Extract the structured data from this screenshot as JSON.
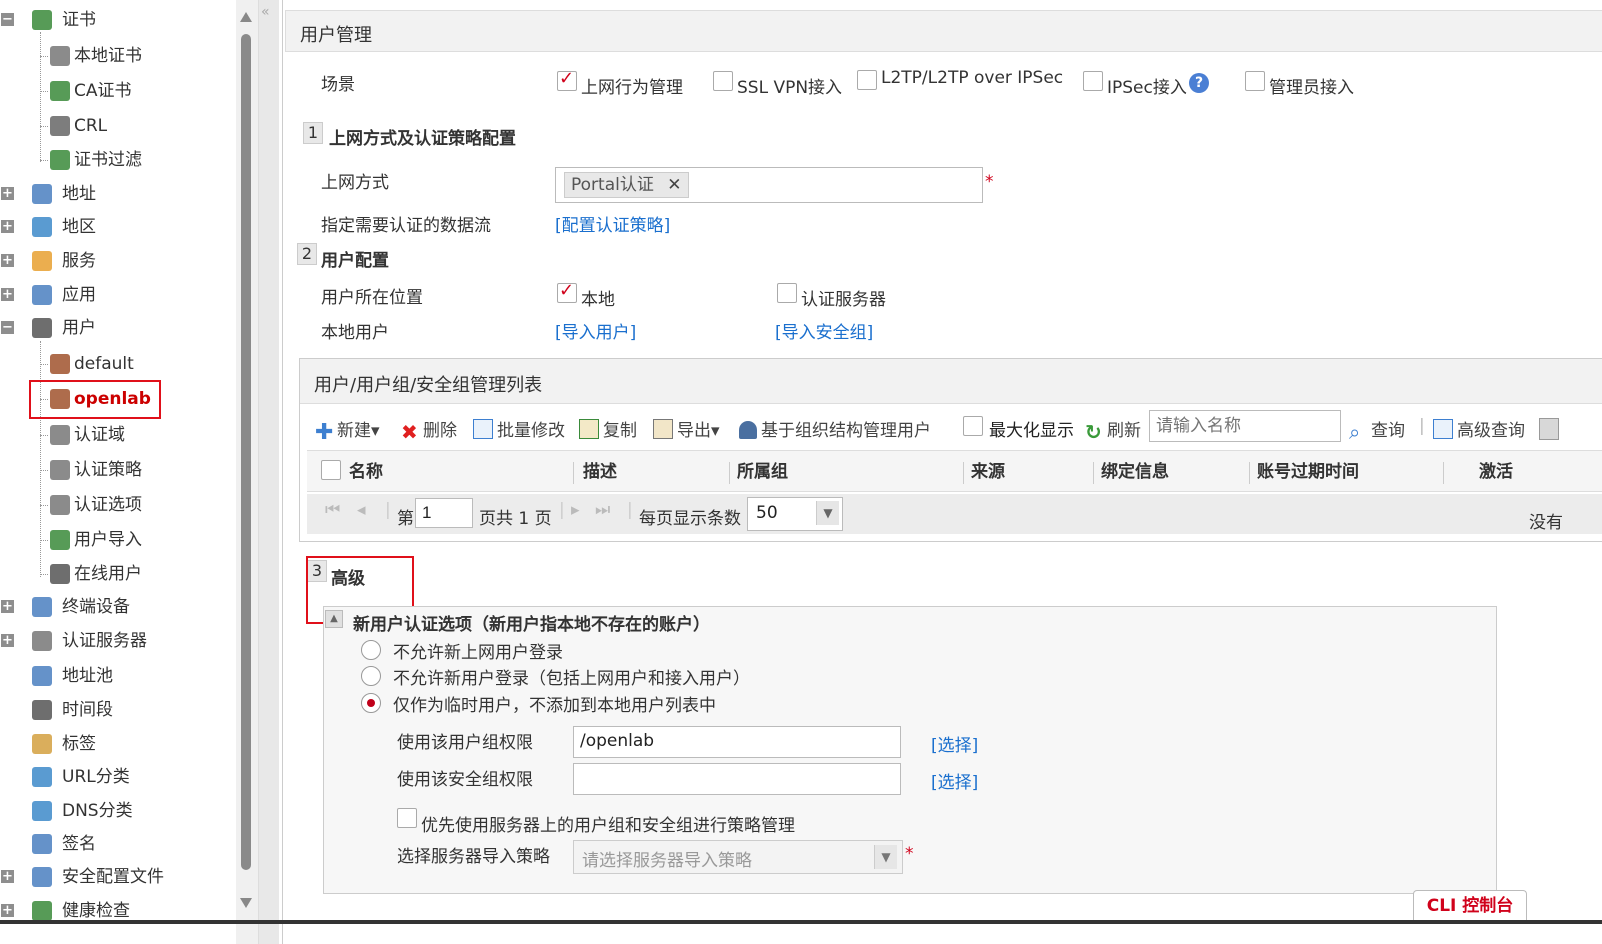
{
  "tree": {
    "items": [
      {
        "label": "证书",
        "level": 0,
        "expand": "minus",
        "color": "#3a8a3a"
      },
      {
        "label": "本地证书",
        "level": 1,
        "color": "#777"
      },
      {
        "label": "CA证书",
        "level": 1,
        "color": "#3a8a3a"
      },
      {
        "label": "CRL",
        "level": 1,
        "color": "#666"
      },
      {
        "label": "证书过滤",
        "level": 1,
        "color": "#3a8a3a"
      },
      {
        "label": "地址",
        "level": 0,
        "expand": "plus",
        "color": "#4a7fc0"
      },
      {
        "label": "地区",
        "level": 0,
        "expand": "plus",
        "color": "#3d8ac9"
      },
      {
        "label": "服务",
        "level": 0,
        "expand": "plus",
        "color": "#e8a030"
      },
      {
        "label": "应用",
        "level": 0,
        "expand": "plus",
        "color": "#4a7fc0"
      },
      {
        "label": "用户",
        "level": 0,
        "expand": "minus",
        "color": "#555"
      },
      {
        "label": "default",
        "level": 1,
        "color": "#a0522d"
      },
      {
        "label": "openlab",
        "level": 1,
        "color": "#a0522d",
        "selected": true
      },
      {
        "label": "认证域",
        "level": 1,
        "color": "#777"
      },
      {
        "label": "认证策略",
        "level": 1,
        "color": "#777"
      },
      {
        "label": "认证选项",
        "level": 1,
        "color": "#777"
      },
      {
        "label": "用户导入",
        "level": 1,
        "color": "#3a8a3a"
      },
      {
        "label": "在线用户",
        "level": 1,
        "color": "#555"
      },
      {
        "label": "终端设备",
        "level": 0,
        "expand": "plus",
        "color": "#4a7fc0"
      },
      {
        "label": "认证服务器",
        "level": 0,
        "expand": "plus",
        "color": "#777"
      },
      {
        "label": "地址池",
        "level": 0,
        "color": "#4a7fc0"
      },
      {
        "label": "时间段",
        "level": 0,
        "color": "#555"
      },
      {
        "label": "标签",
        "level": 0,
        "color": "#d4a040"
      },
      {
        "label": "URL分类",
        "level": 0,
        "color": "#3d8ac9"
      },
      {
        "label": "DNS分类",
        "level": 0,
        "color": "#3d8ac9"
      },
      {
        "label": "签名",
        "level": 0,
        "color": "#4a7fc0"
      },
      {
        "label": "安全配置文件",
        "level": 0,
        "expand": "plus",
        "color": "#4a7fc0"
      },
      {
        "label": "健康检查",
        "level": 0,
        "expand": "plus",
        "color": "#3a8a3a"
      }
    ]
  },
  "main": {
    "panel_title": "用户管理",
    "scene_label": "场景",
    "scenes": [
      {
        "label": "上网行为管理",
        "checked": true
      },
      {
        "label": "SSL VPN接入",
        "checked": false
      },
      {
        "label": "L2TP/L2TP over IPSec",
        "checked": false
      },
      {
        "label": "IPSec接入",
        "checked": false
      },
      {
        "label": "管理员接入",
        "checked": false
      }
    ],
    "help_icon": "question-icon",
    "step1": {
      "num": "1",
      "title": "上网方式及认证策略配置"
    },
    "access_label": "上网方式",
    "access_tag": "Portal认证",
    "required_mark": "*",
    "flow_label": "指定需要认证的数据流",
    "flow_link": "[配置认证策略]",
    "step2": {
      "num": "2",
      "title": "用户配置"
    },
    "location_label": "用户所在位置",
    "loc_local": "本地",
    "loc_server": "认证服务器",
    "local_user_label": "本地用户",
    "import_user_link": "[导入用户]",
    "import_group_link": "[导入安全组]",
    "list_title": "用户/用户组/安全组管理列表",
    "toolbar": {
      "new": "新建",
      "delete": "删除",
      "batch": "批量修改",
      "copy": "复制",
      "export": "导出",
      "org": "基于组织结构管理用户",
      "maximize": "最大化显示",
      "refresh": "刷新",
      "search_placeholder": "请输入名称",
      "query": "查询",
      "advanced": "高级查询"
    },
    "columns": [
      "名称",
      "描述",
      "所属组",
      "来源",
      "绑定信息",
      "账号过期时间",
      "激活"
    ],
    "pager": {
      "page_prefix": "第",
      "page": "1",
      "page_suffix": "页共 1 页",
      "per_page_label": "每页显示条数",
      "per_page": "50",
      "no_records": "没有"
    },
    "step3": {
      "num": "3",
      "title": "高级"
    },
    "new_user_title": "新用户认证选项（新用户指本地不存在的账户）",
    "radios": [
      {
        "label": "不允许新上网用户登录",
        "selected": false
      },
      {
        "label": "不允许新用户登录（包括上网用户和接入用户）",
        "selected": false
      },
      {
        "label": "仅作为临时用户，不添加到本地用户列表中",
        "selected": true
      }
    ],
    "group_perm_label": "使用该用户组权限",
    "group_perm_value": "/openlab",
    "select_link": "[选择]",
    "sec_perm_label": "使用该安全组权限",
    "sec_perm_value": "",
    "prefer_server_label": "优先使用服务器上的用户组和安全组进行策略管理",
    "server_policy_label": "选择服务器导入策略",
    "server_policy_placeholder": "请选择服务器导入策略",
    "cli_button": "CLI 控制台"
  }
}
